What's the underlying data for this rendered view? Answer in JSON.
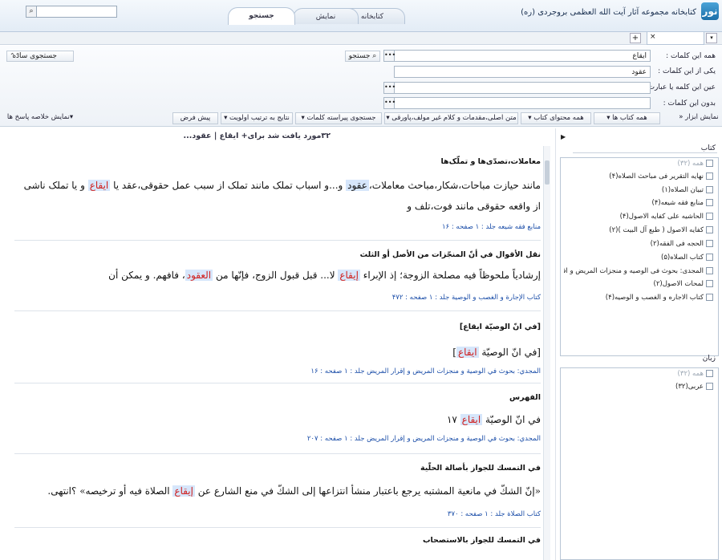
{
  "app": {
    "title": "کتابخانه مجموعه آثار آیت الله العظمی بروجردی (ره)",
    "logo": "نور"
  },
  "tabs": {
    "search": "جستجو",
    "view": "نمایش",
    "library": "کتابخانه"
  },
  "doc_tabs": {
    "close": "×",
    "add": "+",
    "menu": "▾"
  },
  "search_panel": {
    "all_words_label": "همه این کلمات :",
    "all_words_value": "ایقاع",
    "any_words_label": "یکی از این کلمات :",
    "any_words_value": "عقود",
    "exact_phrase_label": "عین این کلمه یا عبارت :",
    "exact_phrase_value": "",
    "without_words_label": "بدون این کلمات :",
    "without_words_value": "",
    "dots": "•••",
    "search_button": "جستجو",
    "simple_search_button": "جستجوی ساده"
  },
  "filters": {
    "show_tools": "نمایش ابزار",
    "all_books": "همه کتاب ها",
    "all_content": "همه محتوای کتاب",
    "text_scope": "متن اصلی،مقدمات و کلام غیر مولف،پاورقی",
    "word_search": "جستجوی پیراسته کلمات",
    "sort_priority": "نتایج به ترتیب اولویت",
    "default": "پیش فرض",
    "summary": "نمایش خلاصه پاسخ ها"
  },
  "results_info": "۳۲مورد یافت شد برای+ ایقاع | عقود...",
  "results": [
    {
      "title": "معاملات،تصدّی‌ها و تملّک‌ها",
      "body_a": "مانند حیازت مباحات،شکار،مباحث معاملات،",
      "hl1": "عقود",
      "body_b": " و...و اسباب تملک مانند تملک از سبب عمل حقوقی،عقد یا ",
      "hl2": "ایقاع",
      "body_c": " و یا تملک ناشی از واقعه حقوقی مانند فوت،تلف و",
      "ref": "منابع فقه شیعه جلد : ۱ صفحه : ۱۶"
    },
    {
      "title": "نقل الأقوال في أنّ المنجّزات من الأصل أو الثلث",
      "body_a": "إرشادياً ملحوظاً فيه مصلحة الزوجة؛ إذ الإبراء ",
      "hl1": "إيقاع",
      "body_b": " لا... قبل قبول الزوج، فإنّها من ",
      "hl2": "العقود",
      "body_c": "، فافهم. و يمكن أن",
      "ref": "كتاب الإجارة و الغصب و الوصية جلد : ۱ صفحه : ۴۷۲"
    },
    {
      "title": "[في انّ الوصيّة ايقاع]",
      "body_a": "[في انّ الوصيّة ",
      "hl1": "ايقاع",
      "body_b": "]",
      "hl2": "",
      "body_c": "",
      "ref": "المجدي: بحوث في الوصية و منجزات المريض و إقرار المريض جلد : ۱ صفحه : ۱۶"
    },
    {
      "title": "الفهرس",
      "body_a": "في انّ الوصيّة ",
      "hl1": "ايقاع",
      "body_b": " ۱۷",
      "hl2": "",
      "body_c": "",
      "ref": "المجدي: بحوث في الوصية و منجزات المريض و إقرار المريض جلد : ۱ صفحه : ۲۰۷"
    },
    {
      "title": "في التمسك للجواز بأصالة الحلّية",
      "body_a": "«إنّ الشكّ في مانعية المشتبه يرجع باعتبار منشأ انتزاعها إلى الشكّ في منع الشارع عن ",
      "hl1": "إيقاع",
      "body_b": " الصلاة فيه أو ترخيصه» ؟انتهى.",
      "hl2": "",
      "body_c": "",
      "ref": "كتاب الصلاة جلد : ۱ صفحه : ۳۷۰"
    },
    {
      "title": "في التمسك للجواز بالاستصحاب",
      "body_a": "",
      "hl1": "",
      "body_b": "",
      "hl2": "",
      "body_c": "",
      "ref": ""
    }
  ],
  "sidebar": {
    "books_heading": "کتاب",
    "books": [
      {
        "label": "همه (۳۲)",
        "muted": true
      },
      {
        "label": "نهایه التقریر فی مباحث الصلاه(۴)"
      },
      {
        "label": "تبیان الصلاه(۱)"
      },
      {
        "label": "منابع فقه شیعه(۴)"
      },
      {
        "label": "الحاشیه علی کفایه الاصول(۴)"
      },
      {
        "label": "کفایه الاصول ( طبع آل البیت )(۲)"
      },
      {
        "label": "الحجه فی الفقه(۲)"
      },
      {
        "label": "کتاب الصلاه(۵)"
      },
      {
        "label": "المجدی: بحوث فی الوصیه و منجزات المریض و اقرار المر"
      },
      {
        "label": "لمحات الاصول(۲)"
      },
      {
        "label": "کتاب الاجاره و الغصب و الوصیه(۴)"
      }
    ],
    "lang_heading": "زبان",
    "languages": [
      {
        "label": "همه (۳۲)",
        "muted": true
      },
      {
        "label": "عربی(۳۲)"
      }
    ]
  },
  "colors": {
    "highlight_bg": "#d6e6fb",
    "highlight_text": "#d0201e",
    "ref_link": "#1a4da8"
  }
}
